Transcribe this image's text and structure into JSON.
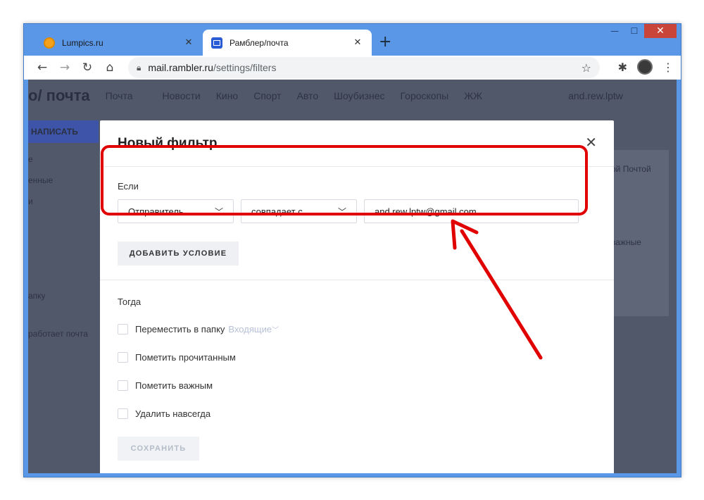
{
  "browser": {
    "tabs": [
      {
        "title": "Lumpics.ru",
        "favicon": "lumpics-orange-icon",
        "active": false
      },
      {
        "title": "Рамблер/почта",
        "favicon": "mail-envelope-icon",
        "active": true
      }
    ],
    "address": {
      "host": "mail.rambler.ru",
      "path": "/settings/filters"
    },
    "window_controls": {
      "minimize": "—",
      "maximize": "☐",
      "close": "✕"
    }
  },
  "background_page": {
    "nav": [
      "o/ почта",
      "Почта",
      "Новости",
      "Кино",
      "Спорт",
      "Авто",
      "Шоубизнес",
      "Гороскопы",
      "ЖЖ"
    ],
    "user": "and.rew.lptw",
    "write_button": "НАПИСАТЬ",
    "sidebar": [
      "е",
      "енные",
      "и",
      "апку",
      "работает почта"
    ],
    "card_texts": [
      "ой Почтой",
      "важные"
    ]
  },
  "modal": {
    "title": "Новый фильтр",
    "if_label": "Если",
    "condition": {
      "field": "Отправитель",
      "operator": "совпадает с",
      "value": "and.rew.lptw@gmail.com"
    },
    "add_condition_label": "ДОБАВИТЬ УСЛОВИЕ",
    "then_label": "Тогда",
    "actions": [
      {
        "label": "Переместить в папку",
        "checked": false
      },
      {
        "label": "Пометить прочитанным",
        "checked": false
      },
      {
        "label": "Пометить важным",
        "checked": false
      },
      {
        "label": "Удалить навсегда",
        "checked": false
      }
    ],
    "folder_value": "Входящие",
    "save_label": "СОХРАНИТЬ"
  },
  "colors": {
    "annotation": "#e00000",
    "window_frame": "#5a97e6",
    "overlay": "#51586a"
  }
}
